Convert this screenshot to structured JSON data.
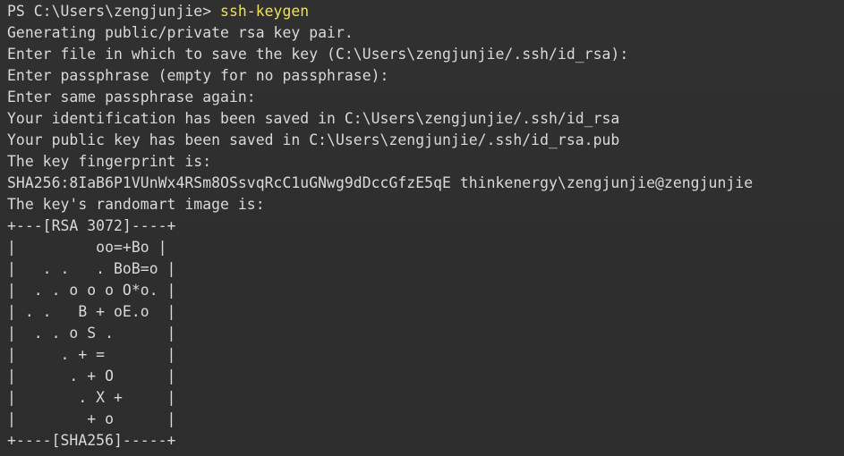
{
  "prompt": {
    "prefix": "PS C:\\Users\\zengjunjie> ",
    "command": "ssh-keygen"
  },
  "output_lines": [
    "Generating public/private rsa key pair.",
    "Enter file in which to save the key (C:\\Users\\zengjunjie/.ssh/id_rsa):",
    "Enter passphrase (empty for no passphrase):",
    "Enter same passphrase again:",
    "Your identification has been saved in C:\\Users\\zengjunjie/.ssh/id_rsa",
    "Your public key has been saved in C:\\Users\\zengjunjie/.ssh/id_rsa.pub",
    "The key fingerprint is:",
    "SHA256:8IaB6P1VUnWx4RSm8OSsvqRcC1uGNwg9dDccGfzE5qE thinkenergy\\zengjunjie@zengjunjie",
    "The key's randomart image is:",
    "+---[RSA 3072]----+",
    "|         oo=+Bo |",
    "|   . .   . BoB=o |",
    "|  . . o o o O*o. |",
    "| . .   B + oE.o  |",
    "|  . . o S .      |",
    "|     . + =       |",
    "|      . + O      |",
    "|       . X +     |",
    "|        + o      |",
    "+----[SHA256]-----+"
  ],
  "colors": {
    "background": "#2d2d2d",
    "text": "#d9d9d9",
    "command": "#f0e24b"
  }
}
